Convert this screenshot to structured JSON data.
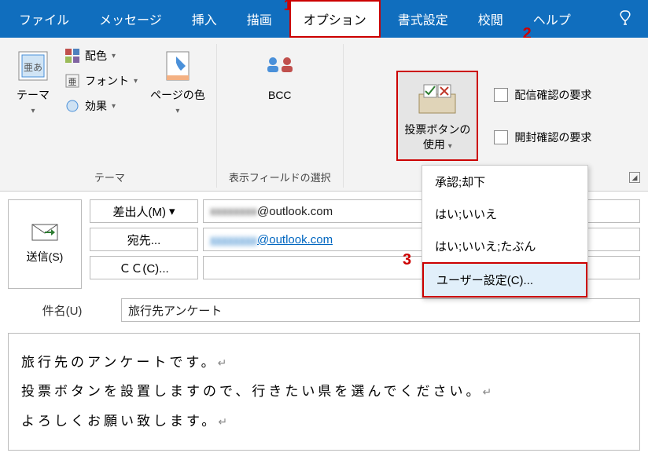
{
  "tabs": {
    "file": "ファイル",
    "message": "メッセージ",
    "insert": "挿入",
    "draw": "描画",
    "options": "オプション",
    "format": "書式設定",
    "review": "校閲",
    "help": "ヘルプ"
  },
  "annotations": {
    "a1": "1",
    "a2": "2",
    "a3": "3"
  },
  "ribbon": {
    "theme_group": {
      "theme_btn": "テーマ",
      "color": "配色",
      "font": "フォント",
      "effect": "効果",
      "page_color": "ページの色",
      "label": "テーマ"
    },
    "fields_group": {
      "bcc": "BCC",
      "label": "表示フィールドの選択"
    },
    "vote_group": {
      "vote_btn_line1": "投票ボタンの",
      "vote_btn_line2": "使用",
      "delivery_receipt": "配信確認の要求",
      "read_receipt": "開封確認の要求"
    }
  },
  "vote_menu": {
    "approve_reject": "承認;却下",
    "yes_no": "はい;いいえ",
    "yes_no_maybe": "はい;いいえ;たぶん",
    "custom": "ユーザー設定(C)..."
  },
  "compose": {
    "send": "送信(S)",
    "from_label": "差出人(M)",
    "from_value": "@outlook.com",
    "to_label": "宛先...",
    "to_value": "@outlook.com",
    "cc_label": "ＣＣ(C)...",
    "subject_label": "件名(U)",
    "subject_value": "旅行先アンケート"
  },
  "body": {
    "p1": "旅行先のアンケートです。",
    "p2": "投票ボタンを設置しますので、行きたい県を選んでください。",
    "p3": "よろしくお願い致します。"
  }
}
